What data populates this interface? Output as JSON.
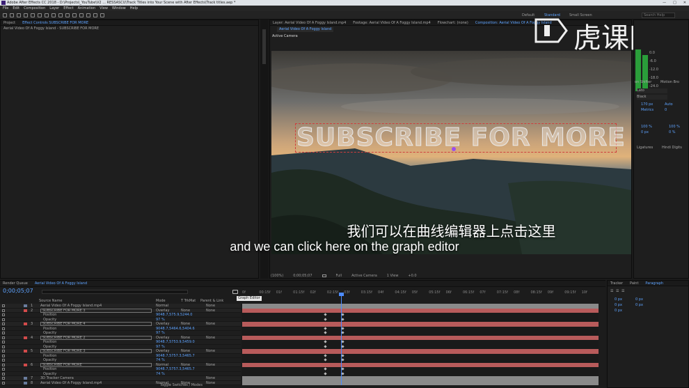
{
  "window": {
    "title": "Adobe After Effects CC 2018 - D:\\Projects\\_YouTube\\V2 ... RESSASCU\\Track Titles into Your Scene with After Effects\\Track titles.aep *",
    "controls": [
      "—",
      "□",
      "✕"
    ]
  },
  "menu": [
    "File",
    "Edit",
    "Composition",
    "Layer",
    "Effect",
    "Animation",
    "View",
    "Window",
    "Help"
  ],
  "workspaces": {
    "items": [
      "Default",
      "Standard",
      "Small Screen"
    ],
    "active": "Standard",
    "search": "Search Help"
  },
  "left_panel": {
    "tabs": [
      "Project",
      "Effect Controls SUBSCRIBE FOR MORE"
    ],
    "subtitle": "Aerial Video Of A Foggy Island - SUBSCRIBE FOR MORE"
  },
  "viewer": {
    "tabs": [
      "Layer: Aerial Video Of A Foggy Island.mp4",
      "Footage: Aerial Video Of A Foggy Island.mp4",
      "Flowchart: (none)",
      "Composition: Aerial Video Of A Foggy Island"
    ],
    "subtab": "Aerial Video Of A Foggy Island",
    "camera_label": "Active Camera",
    "comp_text": "SUBSCRIBE FOR MORE",
    "controls": {
      "zoom": "(100%)",
      "timecode": "0;00;05;07",
      "resolution": "Full",
      "camera": "Active Camera",
      "view": "1 View",
      "offset": "+0.0"
    }
  },
  "subtitles": {
    "cn": "我们可以在曲线编辑器上点击这里",
    "en": "and we can click here on the graph editor"
  },
  "logo": {
    "text": "虎课网"
  },
  "right_panel": {
    "audio_values": [
      "0.0",
      "-6.0",
      "-12.0",
      "-18.0",
      "-24.0"
    ],
    "character_tabs": [
      "on Shifter",
      "Motion Bro"
    ],
    "font": "Lato",
    "style": "Black",
    "font_sizes": [
      "170 px",
      "Auto",
      "Metrics",
      "0"
    ],
    "scale_values": [
      "100 %",
      "100 %",
      "0 px",
      "0 %"
    ],
    "checkboxes": [
      "Ligatures",
      "Hindi Digits"
    ]
  },
  "timeline": {
    "tabs": [
      "Render Queue",
      "Aerial Video Of A Foggy Island"
    ],
    "timecode": "0;00;05;07",
    "graph_tooltip": "Graph Editor",
    "columns": [
      "Source Name",
      "Mode",
      "T TrkMat",
      "Parent & Link"
    ],
    "ruler": [
      "0f",
      "00:15f",
      "01f",
      "01:15f",
      "02f",
      "02:15f",
      "03f",
      "03:15f",
      "04f",
      "04:15f",
      "05f",
      "05:15f",
      "06f",
      "06:15f",
      "07f",
      "07:15f",
      "08f",
      "08:15f",
      "09f",
      "09:15f",
      "10f"
    ],
    "layers": [
      {
        "num": "1",
        "name": "Aerial Video Of A Foggy Island.mp4",
        "mode": "Normal",
        "trk": "",
        "parent": "None",
        "type": "layer"
      },
      {
        "num": "2",
        "name": "SUBSCRIBE FOR MORE 3",
        "mode": "Overlay",
        "trk": "None",
        "parent": "None",
        "type": "layer"
      },
      {
        "num": "",
        "name": "Position",
        "mode": "",
        "trk": "",
        "parent": "",
        "value": "9048.7,575.9,5244.0",
        "type": "prop"
      },
      {
        "num": "",
        "name": "Opacity",
        "mode": "",
        "trk": "",
        "parent": "",
        "value": "97 %",
        "type": "prop"
      },
      {
        "num": "3",
        "name": "SUBSCRIBE FOR MORE 4",
        "mode": "Overlay",
        "trk": "None",
        "parent": "None",
        "type": "layer"
      },
      {
        "num": "",
        "name": "Position",
        "mode": "",
        "trk": "",
        "parent": "",
        "value": "9048.7,5464.6,5404.6",
        "type": "prop"
      },
      {
        "num": "",
        "name": "Opacity",
        "mode": "",
        "trk": "",
        "parent": "",
        "value": "97 %",
        "type": "prop"
      },
      {
        "num": "4",
        "name": "SUBSCRIBE FOR MORE 2",
        "mode": "Overlay",
        "trk": "None",
        "parent": "None",
        "type": "layer"
      },
      {
        "num": "",
        "name": "Position",
        "mode": "",
        "trk": "",
        "parent": "",
        "value": "9048.7,5753.9,5459.0",
        "type": "prop"
      },
      {
        "num": "",
        "name": "Opacity",
        "mode": "",
        "trk": "",
        "parent": "",
        "value": "97 %",
        "type": "prop"
      },
      {
        "num": "5",
        "name": "SUBSCRIBE FOR MORE 3",
        "mode": "Overlay",
        "trk": "None",
        "parent": "None",
        "type": "layer"
      },
      {
        "num": "",
        "name": "Position",
        "mode": "",
        "trk": "",
        "parent": "",
        "value": "9048.7,5757.3,5465.7",
        "type": "prop"
      },
      {
        "num": "",
        "name": "Opacity",
        "mode": "",
        "trk": "",
        "parent": "",
        "value": "74 %",
        "type": "prop"
      },
      {
        "num": "6",
        "name": "SUBSCRIBE FOR MORE",
        "mode": "Normal",
        "trk": "None",
        "parent": "None",
        "type": "layer"
      },
      {
        "num": "",
        "name": "Position",
        "mode": "",
        "trk": "",
        "parent": "",
        "value": "9048.7,5757.3,5465.7",
        "type": "prop"
      },
      {
        "num": "",
        "name": "Opacity",
        "mode": "",
        "trk": "",
        "parent": "",
        "value": "74 %",
        "type": "prop"
      },
      {
        "num": "7",
        "name": "3D Tracker Camera",
        "mode": "",
        "trk": "",
        "parent": "None",
        "type": "layer"
      },
      {
        "num": "8",
        "name": "Aerial Video Of A Foggy Island.mp4",
        "mode": "Normal",
        "trk": "None",
        "parent": "None",
        "type": "layer"
      }
    ],
    "footer": "Toggle Switches / Modes"
  },
  "bottom_right": {
    "tabs": [
      "Tracker",
      "Paint",
      "Paragraph"
    ],
    "active_tab": "Paragraph",
    "values": [
      "0 px",
      "0 px",
      "0 px",
      "0 px",
      "0 px"
    ]
  },
  "colors": {
    "accent": "#5ea3ff",
    "track": "#b85b5b",
    "label_red": "#d34a4a",
    "playhead": "#4d8cff"
  }
}
